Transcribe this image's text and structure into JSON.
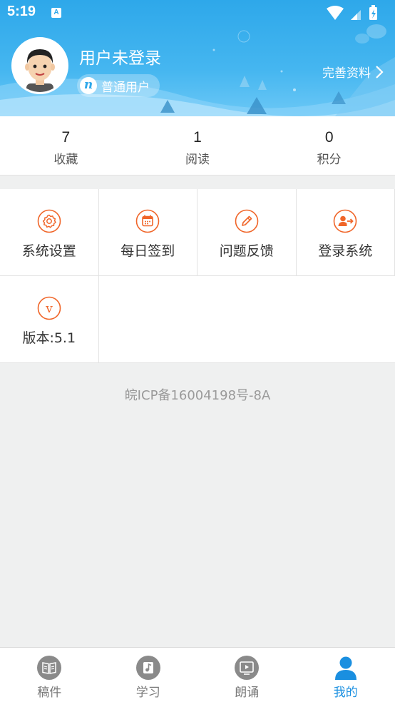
{
  "status_bar": {
    "time": "5:19",
    "notification_letter": "A"
  },
  "profile": {
    "username": "用户未登录",
    "badge_letter": "n",
    "user_level": "普通用户",
    "complete_profile_label": "完善资料"
  },
  "stats": [
    {
      "value": "7",
      "label": "收藏"
    },
    {
      "value": "1",
      "label": "阅读"
    },
    {
      "value": "0",
      "label": "积分"
    }
  ],
  "menu": [
    {
      "label": "系统设置",
      "icon": "gear-icon"
    },
    {
      "label": "每日签到",
      "icon": "calendar-icon"
    },
    {
      "label": "问题反馈",
      "icon": "pencil-icon"
    },
    {
      "label": "登录系统",
      "icon": "login-icon"
    },
    {
      "label": "版本:5.1",
      "icon": "version-icon"
    }
  ],
  "icp": "皖ICP备16004198号-8A",
  "bottom_nav": [
    {
      "label": "稿件",
      "icon": "book-icon",
      "active": false
    },
    {
      "label": "学习",
      "icon": "music-note-icon",
      "active": false
    },
    {
      "label": "朗诵",
      "icon": "video-icon",
      "active": false
    },
    {
      "label": "我的",
      "icon": "person-icon",
      "active": true
    }
  ],
  "colors": {
    "header": "#2ea8ea",
    "accent_orange": "#f0662a",
    "nav_active": "#1a8fe0",
    "nav_inactive": "#8a8a8a"
  }
}
